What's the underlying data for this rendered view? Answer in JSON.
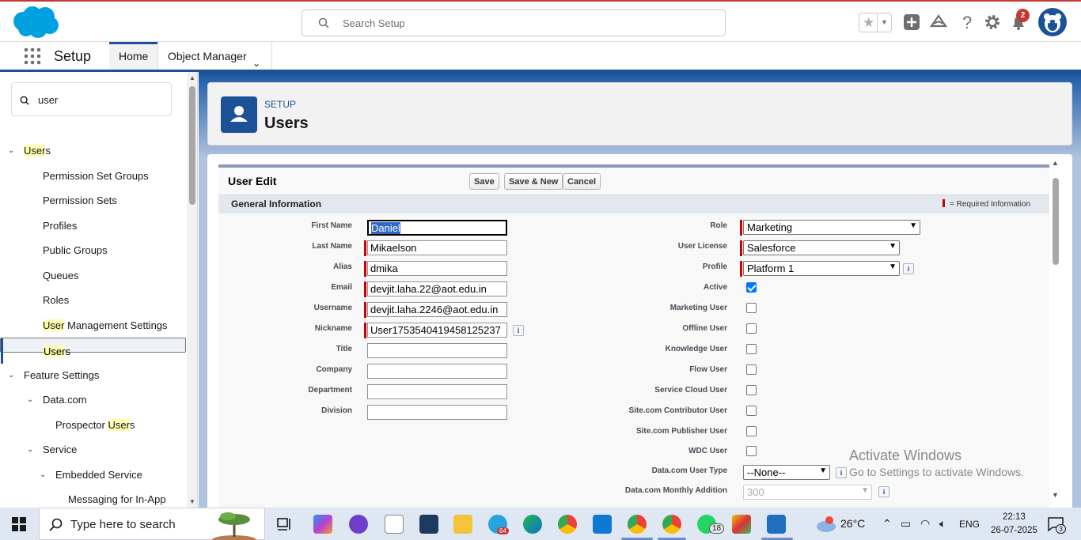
{
  "header": {
    "search_placeholder": "Search Setup",
    "notifications_count": "2"
  },
  "nav": {
    "app_title": "Setup",
    "tabs": [
      {
        "label": "Home",
        "active": true
      },
      {
        "label": "Object Manager",
        "active": false
      }
    ]
  },
  "sidebar": {
    "quick_find_value": "user",
    "items": [
      {
        "pre": "",
        "hl": "User",
        "post": "s"
      },
      {
        "label": "Permission Set Groups"
      },
      {
        "label": "Permission Sets"
      },
      {
        "label": "Profiles"
      },
      {
        "label": "Public Groups"
      },
      {
        "label": "Queues"
      },
      {
        "label": "Roles"
      },
      {
        "pre": "",
        "hl": "User",
        "post": " Management Settings"
      },
      {
        "pre": "",
        "hl": "User",
        "post": "s"
      },
      {
        "label": "Feature Settings"
      },
      {
        "label": "Data.com"
      },
      {
        "pre": "Prospector ",
        "hl": "User",
        "post": "s"
      },
      {
        "label": "Service"
      },
      {
        "label": "Embedded Service"
      },
      {
        "label": "Messaging for In-App"
      }
    ]
  },
  "page_header": {
    "kicker": "SETUP",
    "title": "Users"
  },
  "form": {
    "title": "User Edit",
    "buttons": {
      "save": "Save",
      "save_new": "Save & New",
      "cancel": "Cancel"
    },
    "section_title": "General Information",
    "required_legend": "= Required Information",
    "left": {
      "first_name": {
        "label": "First Name",
        "value": "Daniel"
      },
      "last_name": {
        "label": "Last Name",
        "value": "Mikaelson"
      },
      "alias": {
        "label": "Alias",
        "value": "dmika"
      },
      "email": {
        "label": "Email",
        "value": "devjit.laha.22@aot.edu.in"
      },
      "username": {
        "label": "Username",
        "value": "devjit.laha.2246@aot.edu.in"
      },
      "nickname": {
        "label": "Nickname",
        "value": "User17535404194581252​37"
      },
      "title": {
        "label": "Title",
        "value": ""
      },
      "company": {
        "label": "Company",
        "value": ""
      },
      "department": {
        "label": "Department",
        "value": ""
      },
      "division": {
        "label": "Division",
        "value": ""
      }
    },
    "right": {
      "role": {
        "label": "Role",
        "value": "Marketing"
      },
      "user_license": {
        "label": "User License",
        "value": "Salesforce"
      },
      "profile": {
        "label": "Profile",
        "value": "Platform 1"
      },
      "active": {
        "label": "Active",
        "checked": true
      },
      "marketing_user": {
        "label": "Marketing User",
        "checked": false
      },
      "offline_user": {
        "label": "Offline User",
        "checked": false
      },
      "knowledge_user": {
        "label": "Knowledge User",
        "checked": false
      },
      "flow_user": {
        "label": "Flow User",
        "checked": false
      },
      "service_cloud_user": {
        "label": "Service Cloud User",
        "checked": false
      },
      "site_contributor": {
        "label": "Site.com Contributor User",
        "checked": false
      },
      "site_publisher": {
        "label": "Site.com Publisher User",
        "checked": false
      },
      "wdc_user": {
        "label": "WDC User",
        "checked": false
      },
      "datacom_user_type": {
        "label": "Data.com User Type",
        "value": "--None--"
      },
      "datacom_monthly": {
        "label": "Data.com Monthly Addition",
        "value": "300"
      }
    }
  },
  "watermark": {
    "line1": "Activate Windows",
    "line2": "Go to Settings to activate Windows."
  },
  "taskbar": {
    "search_placeholder": "Type here to search",
    "telegram_badge": "64",
    "whatsapp_badge": "18",
    "weather": "26°C",
    "language": "ENG",
    "time": "22:13",
    "date": "26-07-2025",
    "notification_count": "3"
  }
}
